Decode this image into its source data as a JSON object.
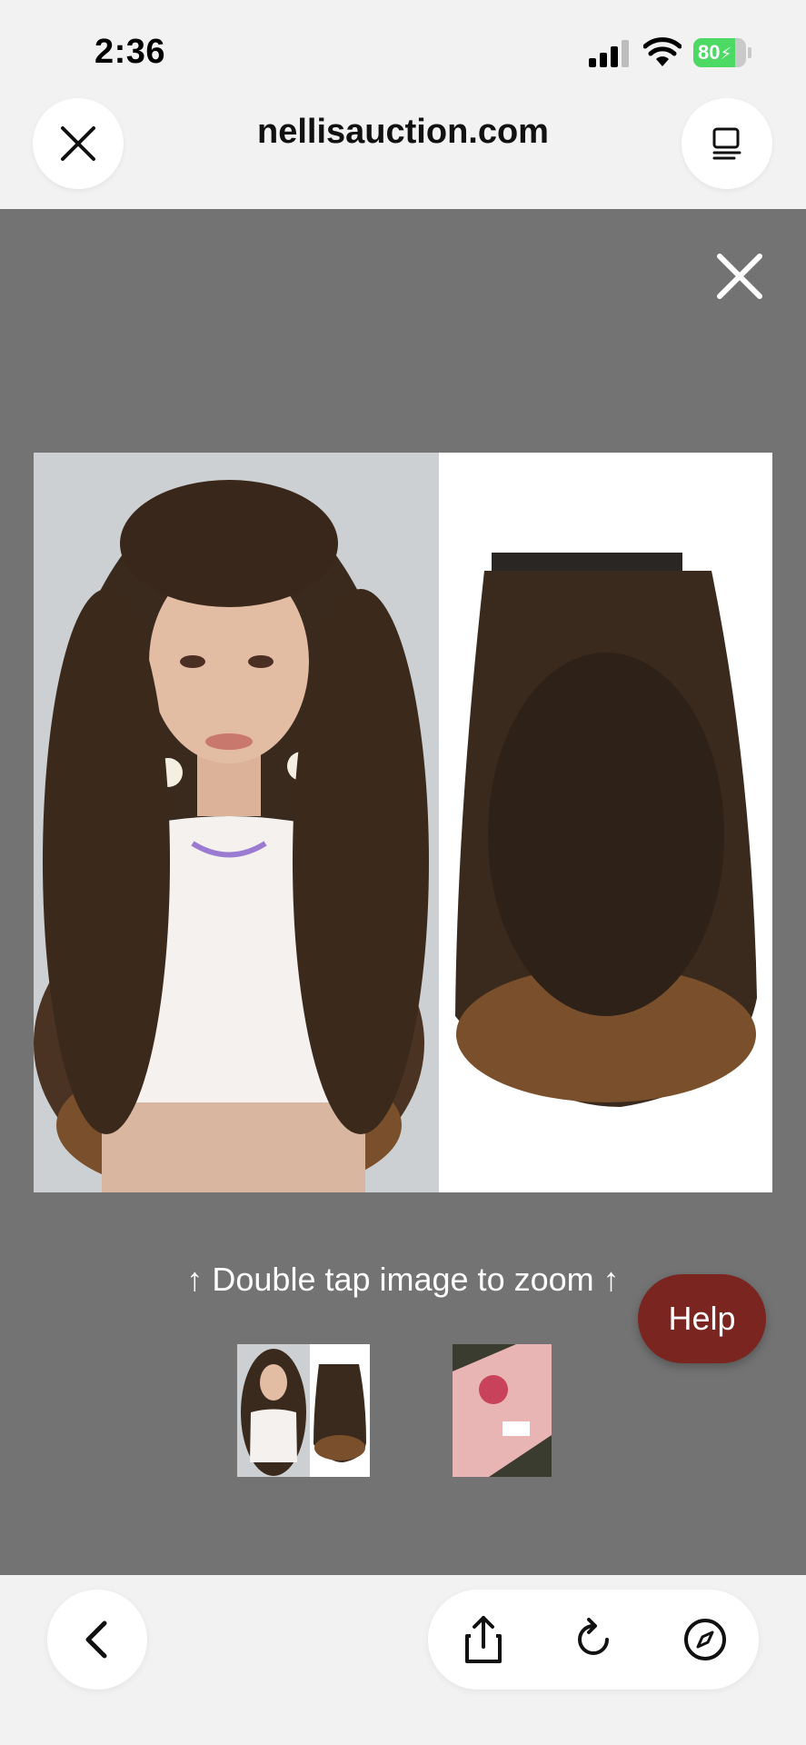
{
  "status_bar": {
    "time": "2:36",
    "battery_percent": "80",
    "battery_level": 0.8,
    "signal_icon": "cellular-signal-icon",
    "wifi_icon": "wifi-icon",
    "charging_icon": "bolt-icon"
  },
  "header": {
    "url": "nellisauction.com",
    "close_icon": "close-icon",
    "tabs_icon": "reader-mode-icon"
  },
  "gallery": {
    "close_icon": "close-icon",
    "zoom_hint": "↑ Double tap image to zoom ↑",
    "help_label": "Help",
    "background_color": "#737373",
    "help_color": "#7a2520",
    "thumbnails": [
      {
        "label": "curly-hair-extensions-thumbnail"
      },
      {
        "label": "product-box-thumbnail"
      }
    ]
  },
  "toolbar": {
    "back_icon": "chevron-left-icon",
    "share_icon": "share-icon",
    "reload_icon": "reload-icon",
    "compass_icon": "compass-icon"
  }
}
